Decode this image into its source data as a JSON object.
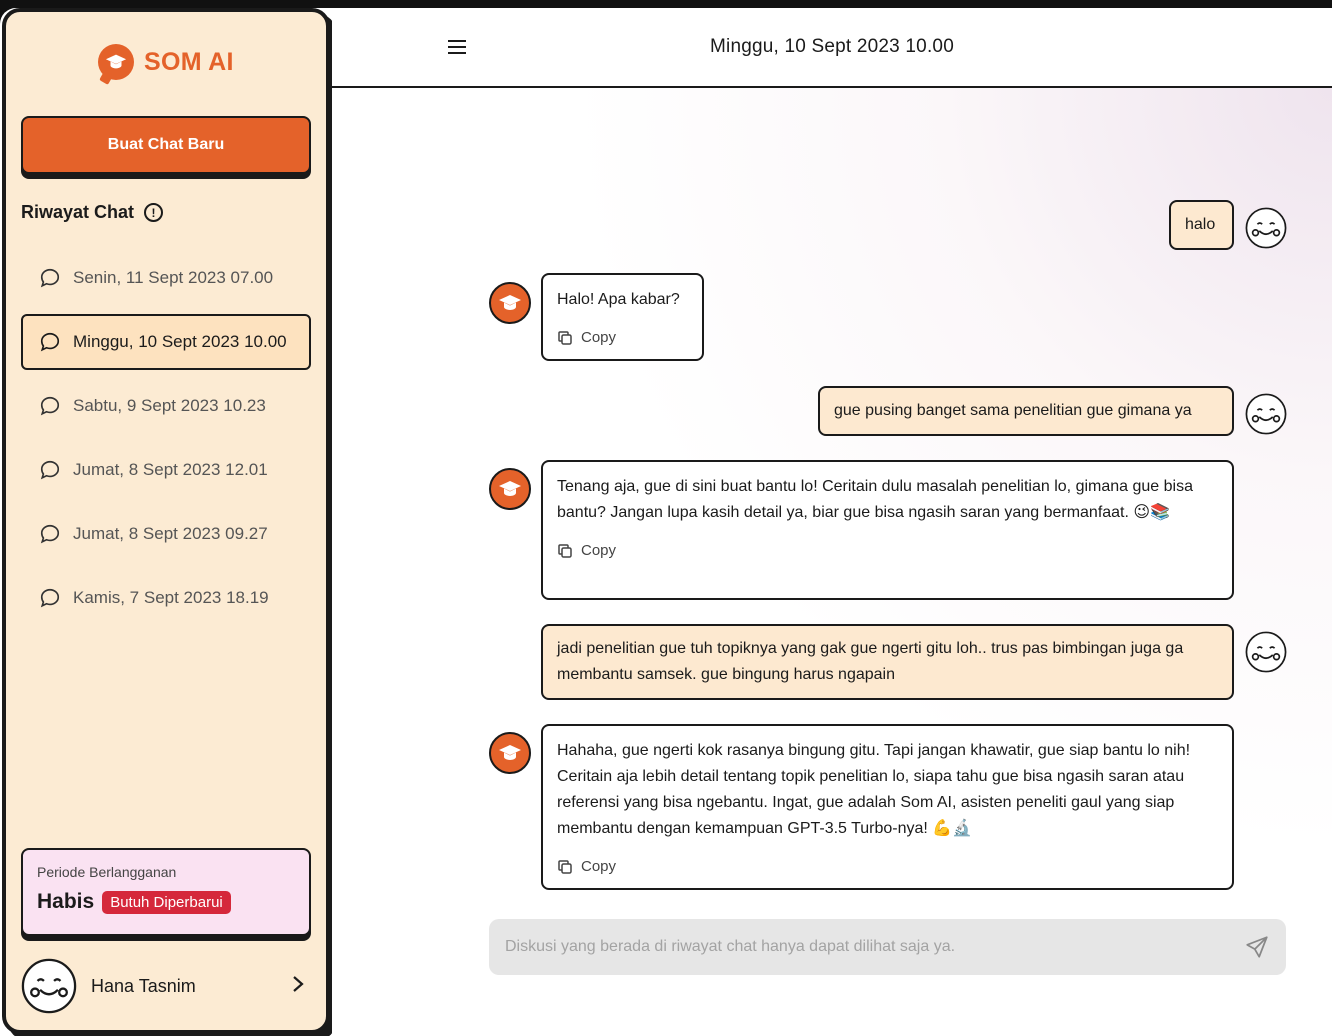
{
  "brand": {
    "name": "SOM AI"
  },
  "sidebar": {
    "new_chat_label": "Buat Chat Baru",
    "history_title": "Riwayat Chat",
    "items": [
      {
        "label": "Senin, 11 Sept 2023   07.00",
        "active": false
      },
      {
        "label": "Minggu, 10 Sept 2023   10.00",
        "active": true
      },
      {
        "label": "Sabtu, 9 Sept 2023   10.23",
        "active": false
      },
      {
        "label": "Jumat, 8 Sept 2023   12.01",
        "active": false
      },
      {
        "label": "Jumat, 8 Sept 2023   09.27",
        "active": false
      },
      {
        "label": "Kamis, 7 Sept 2023   18.19",
        "active": false
      }
    ],
    "subscription": {
      "period_label": "Periode Berlangganan",
      "status": "Habis",
      "badge": "Butuh Diperbarui"
    },
    "user": {
      "name": "Hana Tasnim"
    }
  },
  "header": {
    "title": "Minggu, 10 Sept 2023   10.00"
  },
  "messages": [
    {
      "role": "user",
      "text": "halo"
    },
    {
      "role": "bot",
      "text": "Halo! Apa kabar?"
    },
    {
      "role": "user",
      "text": "gue pusing banget sama penelitian gue gimana ya"
    },
    {
      "role": "bot",
      "text": "Tenang aja, gue di sini buat bantu lo! Ceritain dulu masalah penelitian lo, gimana gue bisa bantu? Jangan lupa kasih detail ya, biar gue bisa ngasih saran yang bermanfaat. 😉📚"
    },
    {
      "role": "user",
      "text": "jadi penelitian gue tuh topiknya yang gak gue ngerti gitu loh.. trus pas bimbingan juga ga membantu samsek. gue bingung harus ngapain"
    },
    {
      "role": "bot",
      "text": "Hahaha, gue ngerti kok rasanya bingung gitu. Tapi jangan khawatir, gue siap bantu lo nih! Ceritain aja lebih detail tentang topik penelitian lo, siapa tahu gue bisa ngasih saran atau referensi yang bisa ngebantu. Ingat, gue adalah Som AI, asisten peneliti gaul yang siap membantu dengan kemampuan GPT-3.5 Turbo-nya! 💪🔬"
    }
  ],
  "copy_label": "Copy",
  "composer": {
    "placeholder": "Diskusi yang berada di riwayat chat hanya dapat dilihat saja ya."
  },
  "colors": {
    "accent": "#e4622a",
    "sidebar_bg": "#fcebd3",
    "user_bubble": "#fde9d0",
    "badge": "#d5283b"
  }
}
